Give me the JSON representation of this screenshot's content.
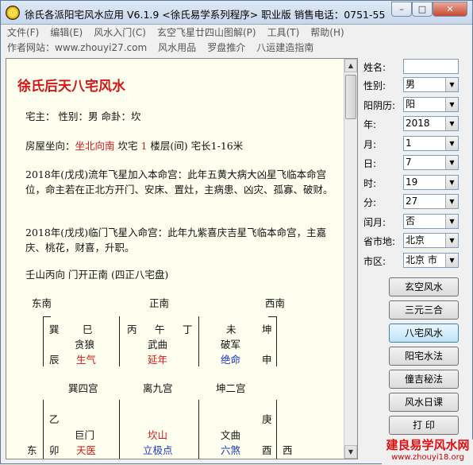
{
  "window": {
    "title": "徐氏各派阳宅风水应用 V6.1.9  <徐氏易学系列程序> 职业版  销售电话：0751-55",
    "btn_min": "–",
    "btn_max": "□",
    "btn_close": "✕"
  },
  "menu": [
    "文件(F)",
    "编辑(E)",
    "风水入门(C)",
    "玄空飞星廿四山图解(P)",
    "工具(T)",
    "帮助(H)"
  ],
  "links": [
    "作者网站：www.zhouyi27.com",
    "风水用品",
    "罗盘推介",
    "八运建造指南"
  ],
  "doc": {
    "heading": "徐氏后天八宅风水",
    "owner_line": "宅主： 性别：男  命卦：坎",
    "house_prefix": "房屋坐向：",
    "house_dir": "坐北向南",
    "house_mid": "  坎宅 ",
    "house_num": "1",
    "house_suffix": " 楼层(间)  宅长1-16米",
    "para1": "2018年(戊戌)流年飞星加入本命宫：此年五黄大病大凶星飞临本命宫位，命主若在正北方开门、安床、置灶，主病患、凶灾、孤寡、破财。",
    "para2": "2018年(戊戌)临门飞星入命宫：此年九紫喜庆吉星飞临本命宫，主嘉庆、桃花，财喜，升职。",
    "summary": "壬山丙向  门开正南  (四正八宅盘)"
  },
  "grid": {
    "dir_se": "东南",
    "dir_s": "正南",
    "dir_sw": "西南",
    "dir_e": "东",
    "dir_w": "西",
    "c1_tl": "巽",
    "c1_tm": "巳",
    "c1_l": "辰",
    "c1_star": "贪狼",
    "c1_sh": "生气",
    "c1_palace": "巽四宫",
    "c2_a": "丙",
    "c2_b": "午",
    "c2_c": "丁",
    "c2_star": "武曲",
    "c2_sh": "延年",
    "c2_palace": "离九宫",
    "c3_a": "未",
    "c3_b": "坤",
    "c3_r": "申",
    "c3_star": "破军",
    "c3_sh": "绝命",
    "c3_palace": "坤二宫",
    "c4_a": "乙",
    "c4_b": "卯",
    "c4_star": "巨门",
    "c4_sh": "天医",
    "c5_star": "坎山",
    "c5_sh": "立极点",
    "c6_a": "庚",
    "c6_b": "酉",
    "c6_star": "文曲",
    "c6_sh": "六煞"
  },
  "form": {
    "name_label": "姓名:",
    "name_value": "",
    "sex_label": "性别:",
    "sex_value": "男",
    "cal_label": "阳阴历:",
    "cal_value": "阳",
    "year_label": "年:",
    "year_value": "2018",
    "month_label": "月:",
    "month_value": "1",
    "day_label": "日:",
    "day_value": "7",
    "hour_label": "时:",
    "hour_value": "19",
    "min_label": "分:",
    "min_value": "27",
    "leap_label": "闰月:",
    "leap_value": "否",
    "prov_label": "省市地:",
    "prov_value": "北京",
    "city_label": "市区:",
    "city_value": "北京 市"
  },
  "buttons": [
    "玄空风水",
    "三元三合",
    "八宅风水",
    "阳宅水法",
    "僮吉秘法",
    "风水日课",
    "打 印"
  ],
  "watermark": {
    "line1": "建良易学风水网",
    "line2": "www.zhouyi18.org"
  },
  "colors": {
    "accent_red": "#d01818",
    "accent_blue": "#1a36c8"
  }
}
